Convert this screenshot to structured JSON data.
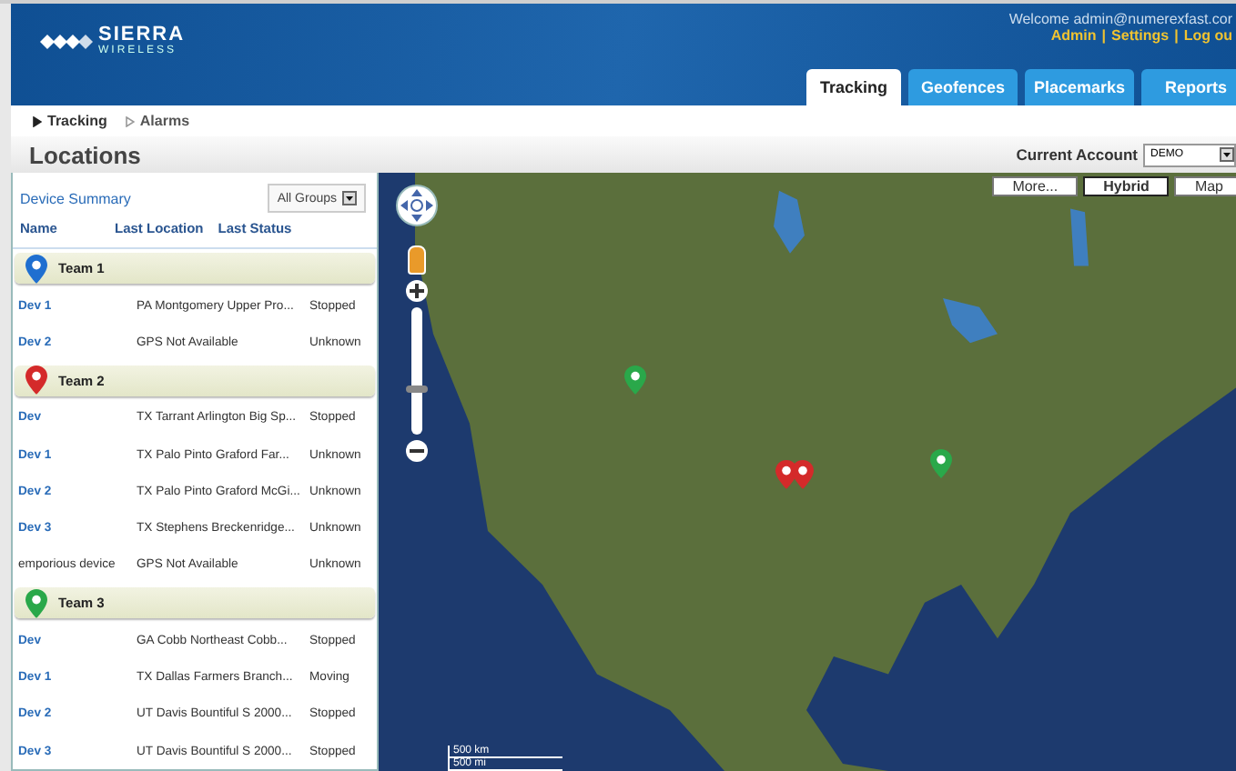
{
  "header": {
    "logo": "SIERRA",
    "logo_sub": "WIRELESS",
    "welcome": "Welcome admin@numerexfast.cor",
    "links": [
      "Admin",
      "Settings",
      "Log ou"
    ],
    "separator": "|"
  },
  "tabs": [
    {
      "label": "Tracking",
      "selected": true
    },
    {
      "label": "Geofences",
      "selected": false
    },
    {
      "label": "Placemarks",
      "selected": false
    },
    {
      "label": "Reports",
      "selected": false
    }
  ],
  "breadcrumb": [
    {
      "label": "Tracking",
      "selected": true
    },
    {
      "label": "Alarms",
      "selected": false
    }
  ],
  "page_title": "Locations",
  "account": {
    "label": "Current Account",
    "value": "DEMO"
  },
  "panel": {
    "title": "Device Summary",
    "group_filter": "All Groups",
    "columns": [
      "Name",
      "Last Location",
      "Last Status"
    ],
    "groups": [
      {
        "name": "Team 1",
        "color": "#1f6fd0",
        "devices": [
          {
            "name": "Dev 1",
            "location": "PA Montgomery Upper Pro...",
            "status": "Stopped",
            "linked": true
          },
          {
            "name": "Dev 2",
            "location": "GPS Not Available",
            "status": "Unknown",
            "linked": true
          }
        ]
      },
      {
        "name": "Team 2",
        "color": "#d42a2a",
        "devices": [
          {
            "name": "Dev",
            "location": "TX Tarrant Arlington Big Sp...",
            "status": "Stopped",
            "linked": true
          },
          {
            "name": "Dev 1",
            "location": "TX Palo Pinto Graford Far...",
            "status": "Unknown",
            "linked": true
          },
          {
            "name": "Dev 2",
            "location": "TX Palo Pinto Graford McGi...",
            "status": "Unknown",
            "linked": true
          },
          {
            "name": "Dev 3",
            "location": "TX Stephens Breckenridge...",
            "status": "Unknown",
            "linked": true
          },
          {
            "name": "emporious device",
            "location": "GPS Not Available",
            "status": "Unknown",
            "linked": false
          }
        ]
      },
      {
        "name": "Team 3",
        "color": "#2aa84a",
        "devices": [
          {
            "name": "Dev",
            "location": "GA Cobb Northeast Cobb...",
            "status": "Stopped",
            "linked": true
          },
          {
            "name": "Dev 1",
            "location": "TX Dallas Farmers Branch...",
            "status": "Moving",
            "linked": true
          },
          {
            "name": "Dev 2",
            "location": "UT Davis Bountiful S 2000...",
            "status": "Stopped",
            "linked": true
          },
          {
            "name": "Dev 3",
            "location": "UT Davis Bountiful S 2000...",
            "status": "Stopped",
            "linked": true
          }
        ]
      }
    ]
  },
  "map": {
    "types": [
      {
        "label": "More...",
        "selected": false
      },
      {
        "label": "Hybrid",
        "selected": true
      },
      {
        "label": "Map",
        "selected": false
      }
    ],
    "zoom": {
      "level": 0.35
    },
    "markers": [
      {
        "color": "#2aa84a"
      },
      {
        "color": "#d42a2a"
      },
      {
        "color": "#d42a2a"
      },
      {
        "color": "#2aa84a"
      }
    ],
    "scale": [
      "500 km",
      "500 mi"
    ]
  }
}
